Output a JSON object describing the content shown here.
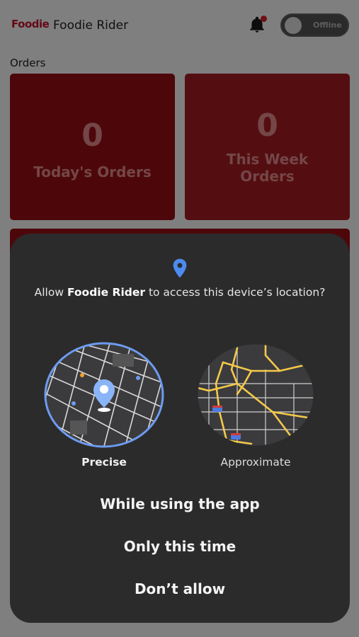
{
  "app": {
    "logo_text": "Foodie",
    "title": "Foodie Rider",
    "status_toggle_label": "Offline",
    "section_title": "Orders"
  },
  "cards": {
    "today": {
      "value": "0",
      "label": "Today's Orders"
    },
    "week": {
      "value": "0",
      "label": "This Week Orders"
    }
  },
  "dialog": {
    "prompt_prefix": "Allow ",
    "app_name": "Foodie Rider",
    "prompt_suffix": " to access this device’s location?",
    "precise_label": "Precise",
    "approximate_label": "Approximate",
    "choices": {
      "while_using": "While using the app",
      "only_this_time": "Only this time",
      "dont_allow": "Don’t allow"
    }
  },
  "icons": {
    "location": "location-pin-icon",
    "notification": "bell-icon"
  },
  "colors": {
    "brand_red": "#c8102e",
    "card_red": "#9b0e14",
    "dialog_bg": "#2b2b2b",
    "accent_blue": "#4d8bf0",
    "map_road_yellow": "#f4c94a"
  }
}
